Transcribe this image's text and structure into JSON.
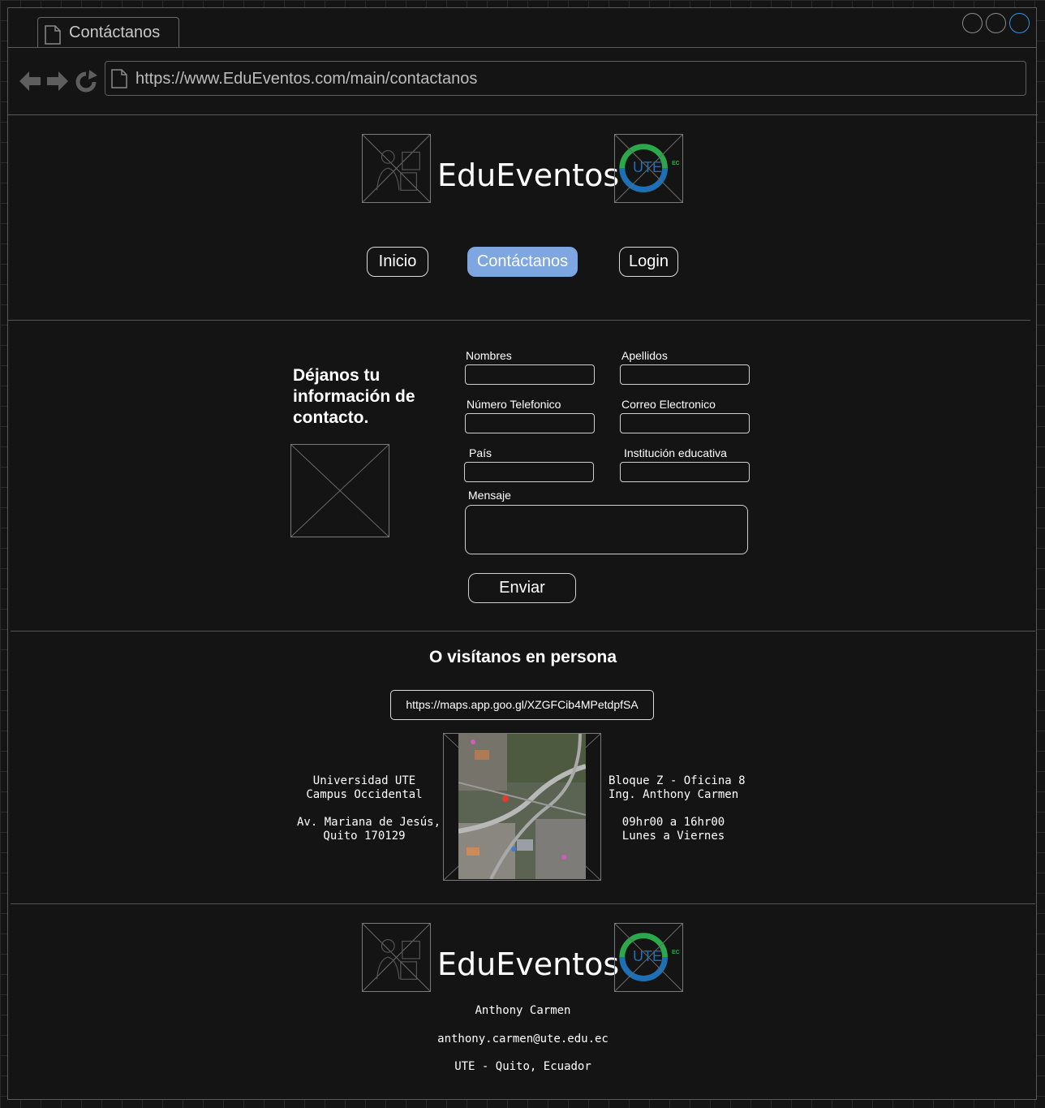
{
  "browser": {
    "tab_title": "Contáctanos",
    "url": "https://www.EduEventos.com/main/contactanos"
  },
  "header": {
    "brand": "EduEventos",
    "logo_badge_text": "UTE",
    "logo_badge_suffix": "EC"
  },
  "nav": {
    "items": [
      {
        "label": "Inicio",
        "active": false
      },
      {
        "label": "Contáctanos",
        "active": true
      },
      {
        "label": "Login",
        "active": false
      }
    ],
    "active_color": "#7ea6e0"
  },
  "contact_form": {
    "title": "Déjanos tu información de contacto.",
    "fields": {
      "first_name": {
        "label": "Nombres",
        "value": ""
      },
      "last_name": {
        "label": "Apellidos",
        "value": ""
      },
      "phone": {
        "label": "Número Telefonico",
        "value": ""
      },
      "email": {
        "label": "Correo Electronico",
        "value": ""
      },
      "country": {
        "label": "País",
        "value": ""
      },
      "institution": {
        "label": "Institución educativa",
        "value": ""
      },
      "message": {
        "label": "Mensaje",
        "value": ""
      }
    },
    "submit_label": "Enviar"
  },
  "visit": {
    "title": "O visítanos en persona",
    "map_link": "https://maps.app.goo.gl/XZGFCib4MPetdpfSA",
    "left_info": [
      "Universidad UTE",
      "Campus Occidental",
      "",
      "Av. Mariana de Jesús,",
      "Quito 170129"
    ],
    "right_info": [
      "Bloque Z - Oficina 8",
      "Ing. Anthony Carmen",
      "",
      "09hr00 a 16hr00",
      "Lunes a Viernes"
    ]
  },
  "footer": {
    "brand": "EduEventos",
    "name": "Anthony Carmen",
    "email": "anthony.carmen@ute.edu.ec",
    "location": "UTE - Quito, Ecuador"
  },
  "colors": {
    "background": "#141414",
    "logo_green": "#2aa84a",
    "logo_blue": "#1d6fb8"
  }
}
